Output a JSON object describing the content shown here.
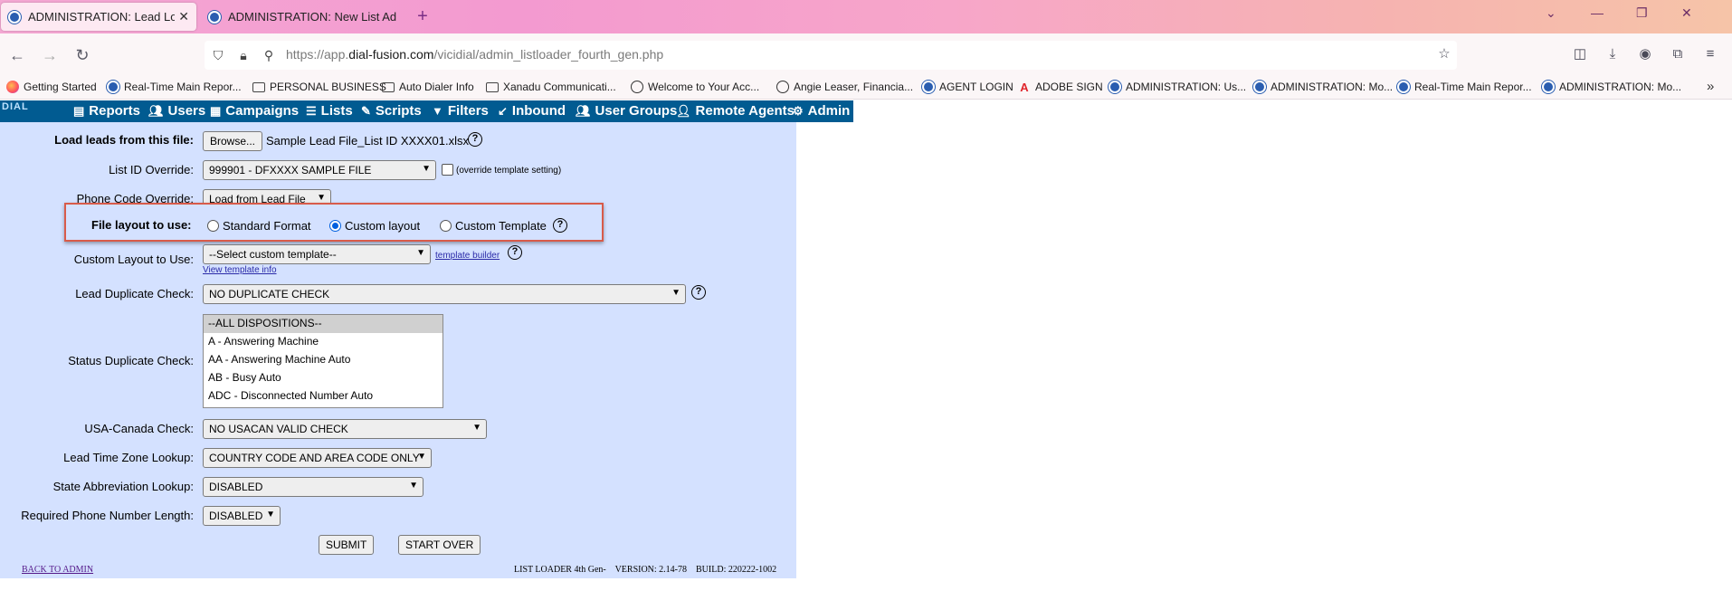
{
  "browser": {
    "tabs": [
      {
        "title": "ADMINISTRATION: Lead Loader",
        "active": true
      },
      {
        "title": "ADMINISTRATION: New List Ad",
        "active": false
      }
    ],
    "url_prefix": "https://app.",
    "url_domain": "dial-fusion.com",
    "url_path": "/vicidial/admin_listloader_fourth_gen.php",
    "bookmarks": [
      {
        "label": "Getting Started",
        "icon": "firefox-icon"
      },
      {
        "label": "Real-Time Main Repor...",
        "icon": "vicidial-icon"
      },
      {
        "label": "PERSONAL BUSINESS",
        "icon": "folder-icon"
      },
      {
        "label": "Auto Dialer Info",
        "icon": "folder-icon"
      },
      {
        "label": "Xanadu Communicati...",
        "icon": "folder-icon"
      },
      {
        "label": "Welcome to Your Acc...",
        "icon": "globe-icon"
      },
      {
        "label": "Angie Leaser, Financia...",
        "icon": "globe-icon"
      },
      {
        "label": "AGENT LOGIN",
        "icon": "vicidial-icon"
      },
      {
        "label": "ADOBE SIGN",
        "icon": "adobe-icon"
      },
      {
        "label": "ADMINISTRATION: Us...",
        "icon": "vicidial-icon"
      },
      {
        "label": "ADMINISTRATION: Mo...",
        "icon": "vicidial-icon"
      },
      {
        "label": "Real-Time Main Repor...",
        "icon": "vicidial-icon"
      },
      {
        "label": "ADMINISTRATION: Mo...",
        "icon": "vicidial-icon"
      }
    ]
  },
  "header": {
    "logo": "DIAL",
    "menu": [
      "Reports",
      "Users",
      "Campaigns",
      "Lists",
      "Scripts",
      "Filters",
      "Inbound",
      "User Groups",
      "Remote Agents",
      "Admin"
    ]
  },
  "form": {
    "load_file_label": "Load leads from this file:",
    "browse_button": "Browse...",
    "file_name": "Sample Lead File_List ID XXXX01.xlsx",
    "list_id_label": "List ID Override:",
    "list_id_value": "999901 - DFXXXX SAMPLE FILE",
    "override_template_note": "(override template setting)",
    "phone_code_label": "Phone Code Override:",
    "phone_code_value": "Load from Lead File",
    "file_layout_label": "File layout to use:",
    "layout_options": [
      "Standard Format",
      "Custom layout",
      "Custom Template"
    ],
    "layout_selected": "Custom layout",
    "custom_layout_label": "Custom Layout to Use:",
    "custom_layout_value": "--Select custom template--",
    "template_builder_link": "template builder",
    "view_template_link": "View template info",
    "lead_dup_label": "Lead Duplicate Check:",
    "lead_dup_value": "NO DUPLICATE CHECK",
    "status_dup_label": "Status Duplicate Check:",
    "status_options": [
      "--ALL DISPOSITIONS--",
      "A - Answering Machine",
      "AA - Answering Machine Auto",
      "AB - Busy Auto",
      "ADC - Disconnected Number Auto"
    ],
    "usa_canada_label": "USA-Canada Check:",
    "usa_canada_value": "NO USACAN VALID CHECK",
    "timezone_label": "Lead Time Zone Lookup:",
    "timezone_value": "COUNTRY CODE AND AREA CODE ONLY",
    "state_abbrev_label": "State Abbreviation Lookup:",
    "state_abbrev_value": "DISABLED",
    "phone_length_label": "Required Phone Number Length:",
    "phone_length_value": "DISABLED",
    "submit_button": "SUBMIT",
    "start_over_button": "START OVER",
    "back_link": "BACK TO ADMIN",
    "version_text": "LIST LOADER 4th Gen-    VERSION: 2.14-78    BUILD: 220222-1002"
  },
  "colors": {
    "header_bg": "#015b91",
    "panel_bg": "#d4e1ff",
    "highlight_border": "#d85b4a"
  }
}
